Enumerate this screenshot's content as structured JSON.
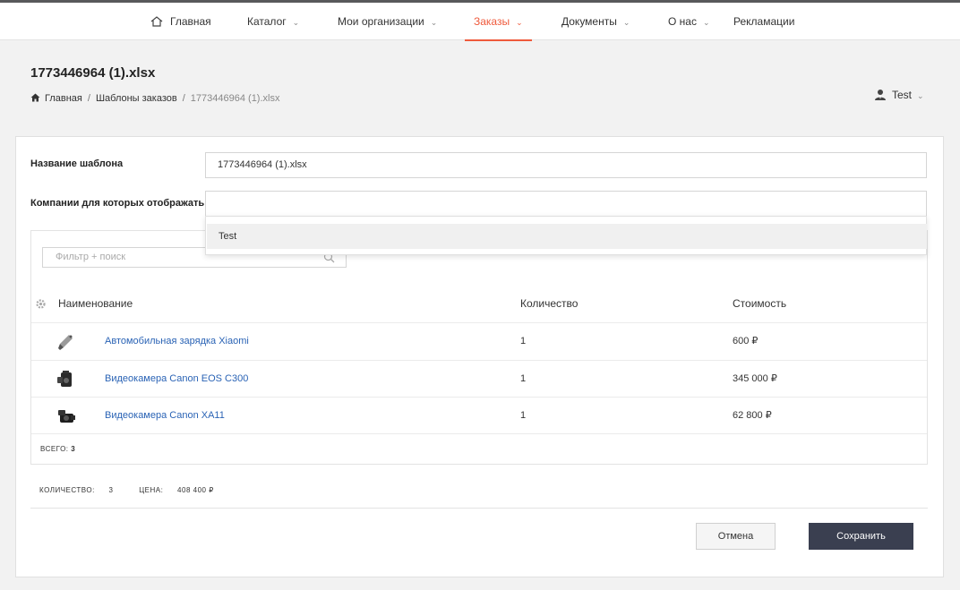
{
  "nav": {
    "items": [
      {
        "label": "Главная",
        "active": false,
        "has_dropdown": false
      },
      {
        "label": "Каталог",
        "active": false,
        "has_dropdown": true
      },
      {
        "label": "Мои организации",
        "active": false,
        "has_dropdown": true
      },
      {
        "label": "Заказы",
        "active": true,
        "has_dropdown": true
      },
      {
        "label": "Документы",
        "active": false,
        "has_dropdown": true
      },
      {
        "label": "О нас",
        "active": false,
        "has_dropdown": true
      },
      {
        "label": "Рекламации",
        "active": false,
        "has_dropdown": false
      }
    ],
    "accent_color": "#ef5a3c"
  },
  "page": {
    "title": "1773446964 (1).xlsx",
    "breadcrumb": [
      "Главная",
      "Шаблоны заказов",
      "1773446964 (1).xlsx"
    ]
  },
  "user": {
    "name": "Test"
  },
  "form": {
    "template_name_label": "Название шаблона",
    "template_name_value": "1773446964 (1).xlsx",
    "companies_label": "Компании для которых отображать",
    "companies_value": "",
    "dropdown_options": [
      "Test"
    ]
  },
  "table": {
    "filter_placeholder": "Фильтр + поиск",
    "columns": [
      "Наименование",
      "Количество",
      "Стоимость"
    ],
    "rows": [
      {
        "name": "Автомобильная зарядка Xiaomi",
        "qty": "1",
        "price": "600 ₽",
        "icon": "car-charger-icon"
      },
      {
        "name": "Видеокамера Canon EOS C300",
        "qty": "1",
        "price": "345 000 ₽",
        "icon": "video-camera-icon"
      },
      {
        "name": "Видеокамера Canon XA11",
        "qty": "1",
        "price": "62 800 ₽",
        "icon": "camcorder-icon"
      }
    ],
    "total_label": "ВСЕГО:",
    "total_value": "3"
  },
  "summary": {
    "qty_label": "КОЛИЧЕСТВО:",
    "qty_value": "3",
    "price_label": "ЦЕНА:",
    "price_value": "408 400 ₽"
  },
  "buttons": {
    "cancel": "Отмена",
    "save": "Сохранить"
  },
  "colors": {
    "link": "#2a63b5",
    "save_button": "#3a3f50"
  }
}
